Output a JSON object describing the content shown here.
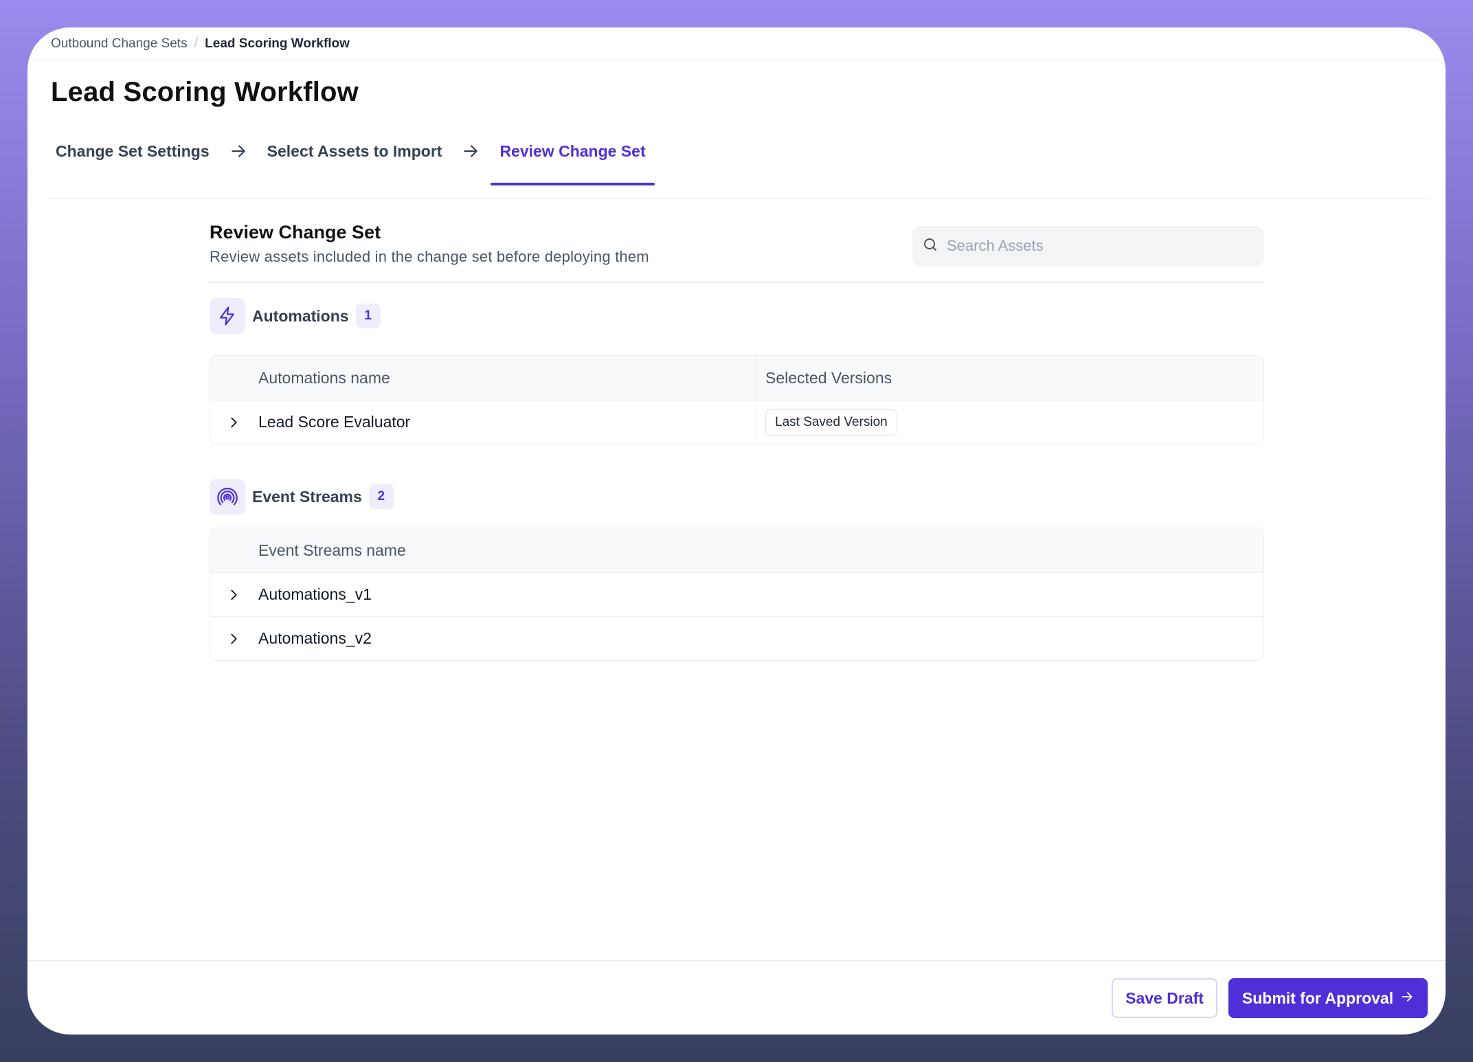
{
  "breadcrumb": {
    "parent": "Outbound Change Sets",
    "separator": "/",
    "current": "Lead Scoring Workflow"
  },
  "page": {
    "title": "Lead Scoring Workflow"
  },
  "steps": [
    {
      "label": "Change Set Settings",
      "state": "complete"
    },
    {
      "label": "Select Assets to Import",
      "state": "complete"
    },
    {
      "label": "Review Change Set",
      "state": "active"
    }
  ],
  "review": {
    "title": "Review Change Set",
    "subtitle": "Review assets included in the change set before deploying them",
    "search_placeholder": "Search Assets"
  },
  "automations": {
    "label": "Automations",
    "count": "1",
    "icon": "lightning-icon",
    "columns": [
      "Automations name",
      "Selected Versions"
    ],
    "rows": [
      {
        "name": "Lead Score Evaluator",
        "version": "Last Saved Version"
      }
    ]
  },
  "event_streams": {
    "label": "Event Streams",
    "count": "2",
    "icon": "broadcast-icon",
    "columns": [
      "Event Streams name"
    ],
    "rows": [
      {
        "name": "Automations_v1"
      },
      {
        "name": "Automations_v2"
      }
    ]
  },
  "footer": {
    "save_label": "Save Draft",
    "submit_label": "Submit for Approval"
  },
  "colors": {
    "accent": "#4f2fd8",
    "accent_soft": "#eeedfb",
    "background_top": "#9a8cee",
    "background_bottom": "#383f5e"
  }
}
